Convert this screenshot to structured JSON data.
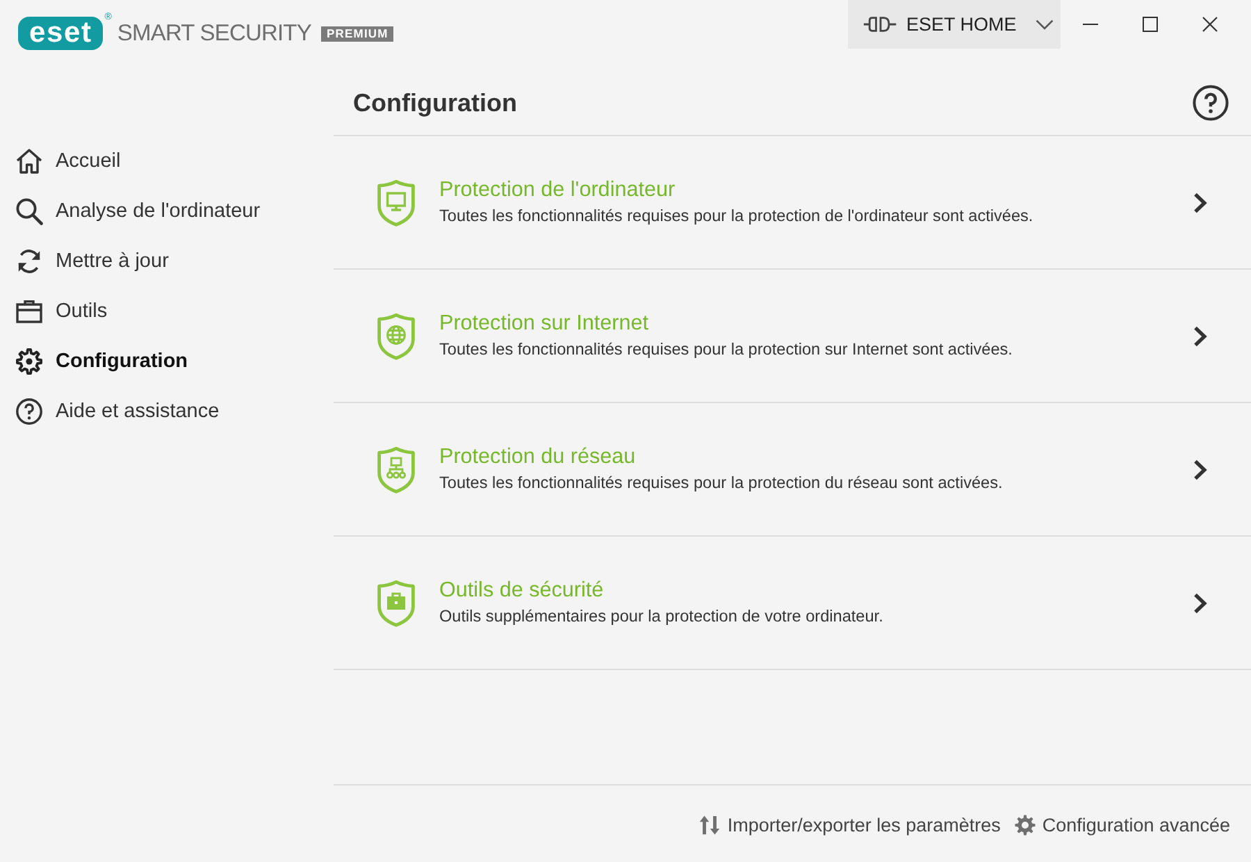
{
  "window": {
    "logo": "eset",
    "registered_mark": "®",
    "product": "SMART SECURITY",
    "edition": "PREMIUM",
    "account_button": "ESET HOME"
  },
  "sidebar": {
    "items": [
      {
        "label": "Accueil",
        "selected": false
      },
      {
        "label": "Analyse de l'ordinateur",
        "selected": false
      },
      {
        "label": "Mettre à jour",
        "selected": false
      },
      {
        "label": "Outils",
        "selected": false
      },
      {
        "label": "Configuration",
        "selected": true
      },
      {
        "label": "Aide et assistance",
        "selected": false
      }
    ]
  },
  "page": {
    "title": "Configuration"
  },
  "sections": [
    {
      "title": "Protection de l'ordinateur",
      "description": "Toutes les fonctionnalités requises pour la protection de l'ordinateur sont activées."
    },
    {
      "title": "Protection sur Internet",
      "description": "Toutes les fonctionnalités requises pour la protection sur Internet sont activées."
    },
    {
      "title": "Protection du réseau",
      "description": "Toutes les fonctionnalités requises pour la protection du réseau sont activées."
    },
    {
      "title": "Outils de sécurité",
      "description": "Outils supplémentaires pour la protection de votre ordinateur."
    }
  ],
  "footer": {
    "links": [
      {
        "label": "Importer/exporter les paramètres"
      },
      {
        "label": "Configuration avancée"
      }
    ]
  }
}
